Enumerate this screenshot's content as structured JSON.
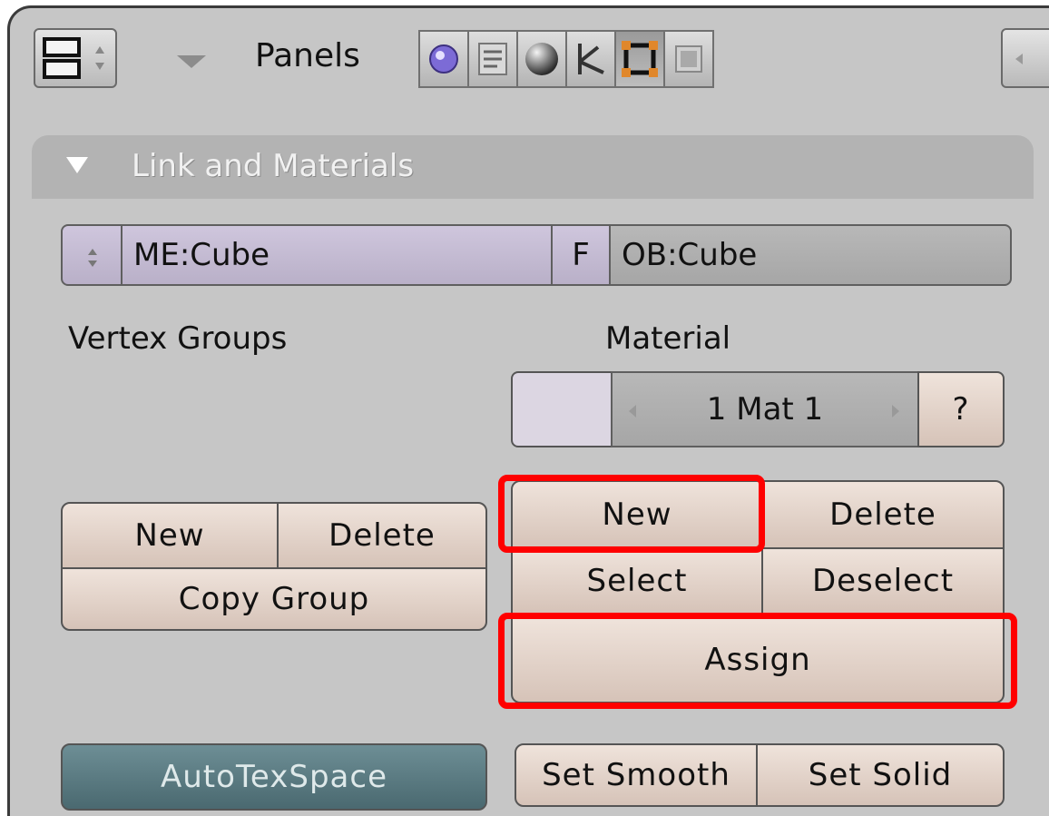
{
  "header": {
    "panels_label": "Panels",
    "icons": [
      "logic-icon",
      "script-icon",
      "shading-icon",
      "object-icon",
      "editing-icon",
      "scene-icon"
    ]
  },
  "panel": {
    "title": "Link and Materials",
    "mesh_field": "ME:Cube",
    "f_button": "F",
    "object_field": "OB:Cube",
    "vertex_groups_label": "Vertex Groups",
    "material_label": "Material",
    "material_selector": {
      "value": "1 Mat 1",
      "help_label": "?"
    },
    "vertex_groups": {
      "new_label": "New",
      "delete_label": "Delete",
      "copy_group_label": "Copy Group"
    },
    "material_buttons": {
      "new_label": "New",
      "delete_label": "Delete",
      "select_label": "Select",
      "deselect_label": "Deselect",
      "assign_label": "Assign"
    },
    "autotexspace_label": "AutoTexSpace",
    "set_smooth_label": "Set Smooth",
    "set_solid_label": "Set Solid"
  },
  "colors": {
    "highlight": "#ff0000",
    "button": "#e3d3c9",
    "autotexspace": "#5b7b82",
    "background": "#c6c6c6"
  }
}
